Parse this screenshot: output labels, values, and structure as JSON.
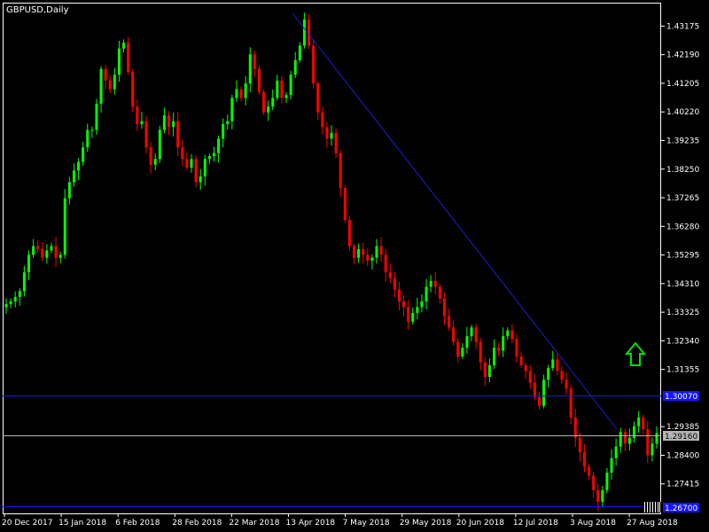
{
  "window": {
    "symbol_label": "GBPUSD,Daily",
    "colors": {
      "background": "#000000",
      "frame": "#ffffff",
      "bull": "#00ff00",
      "bear": "#ff0000",
      "trendline": "#1e1ec8",
      "level_line": "#1414ff",
      "price_line": "#b4b4b4",
      "arrow": "#00e000"
    }
  },
  "chart_data": {
    "type": "candlestick",
    "timeframe": "Daily",
    "y_ticks": [
      "1.43175",
      "1.42190",
      "1.41205",
      "1.40220",
      "1.39235",
      "1.38250",
      "1.37265",
      "1.36280",
      "1.35295",
      "1.34310",
      "1.33325",
      "1.32340",
      "1.31355",
      "1.29385",
      "1.28400",
      "1.27415"
    ],
    "x_ticks": [
      "20 Dec 2017",
      "15 Jan 2018",
      "6 Feb 2018",
      "28 Feb 2018",
      "22 Mar 2018",
      "13 Apr 2018",
      "7 May 2018",
      "29 May 2018",
      "20 Jun 2018",
      "12 Jul 2018",
      "3 Aug 2018",
      "27 Aug 2018"
    ],
    "ylim": [
      1.264,
      1.4395
    ],
    "closes": [
      1.336,
      1.337,
      1.3385,
      1.3405,
      1.347,
      1.353,
      1.356,
      1.355,
      1.352,
      1.3545,
      1.356,
      1.352,
      1.353,
      1.3725,
      1.378,
      1.382,
      1.385,
      1.39,
      1.396,
      1.396,
      1.405,
      1.417,
      1.413,
      1.41,
      1.415,
      1.424,
      1.426,
      1.416,
      1.404,
      1.398,
      1.399,
      1.39,
      1.384,
      1.386,
      1.396,
      1.401,
      1.397,
      1.399,
      1.39,
      1.386,
      1.383,
      1.386,
      1.378,
      1.38,
      1.386,
      1.387,
      1.388,
      1.393,
      1.398,
      1.399,
      1.407,
      1.41,
      1.407,
      1.412,
      1.422,
      1.417,
      1.409,
      1.402,
      1.404,
      1.407,
      1.413,
      1.407,
      1.408,
      1.415,
      1.42,
      1.425,
      1.434,
      1.425,
      1.412,
      1.402,
      1.397,
      1.393,
      1.395,
      1.388,
      1.376,
      1.365,
      1.356,
      1.352,
      1.355,
      1.353,
      1.351,
      1.352,
      1.356,
      1.353,
      1.347,
      1.345,
      1.341,
      1.337,
      1.335,
      1.33,
      1.333,
      1.335,
      1.337,
      1.342,
      1.344,
      1.342,
      1.338,
      1.332,
      1.328,
      1.323,
      1.318,
      1.321,
      1.325,
      1.328,
      1.323,
      1.316,
      1.311,
      1.315,
      1.321,
      1.32,
      1.325,
      1.327,
      1.324,
      1.318,
      1.315,
      1.313,
      1.309,
      1.304,
      1.301,
      1.31,
      1.314,
      1.317,
      1.313,
      1.31,
      1.307,
      1.297,
      1.29,
      1.285,
      1.28,
      1.277,
      1.272,
      1.268,
      1.272,
      1.278,
      1.283,
      1.287,
      1.292,
      1.288,
      1.29,
      1.294,
      1.297,
      1.293,
      1.284,
      1.288,
      1.2916
    ]
  },
  "levels": {
    "upper_price": "1.30070",
    "lower_price": "1.26700",
    "current_price": "1.29160"
  }
}
